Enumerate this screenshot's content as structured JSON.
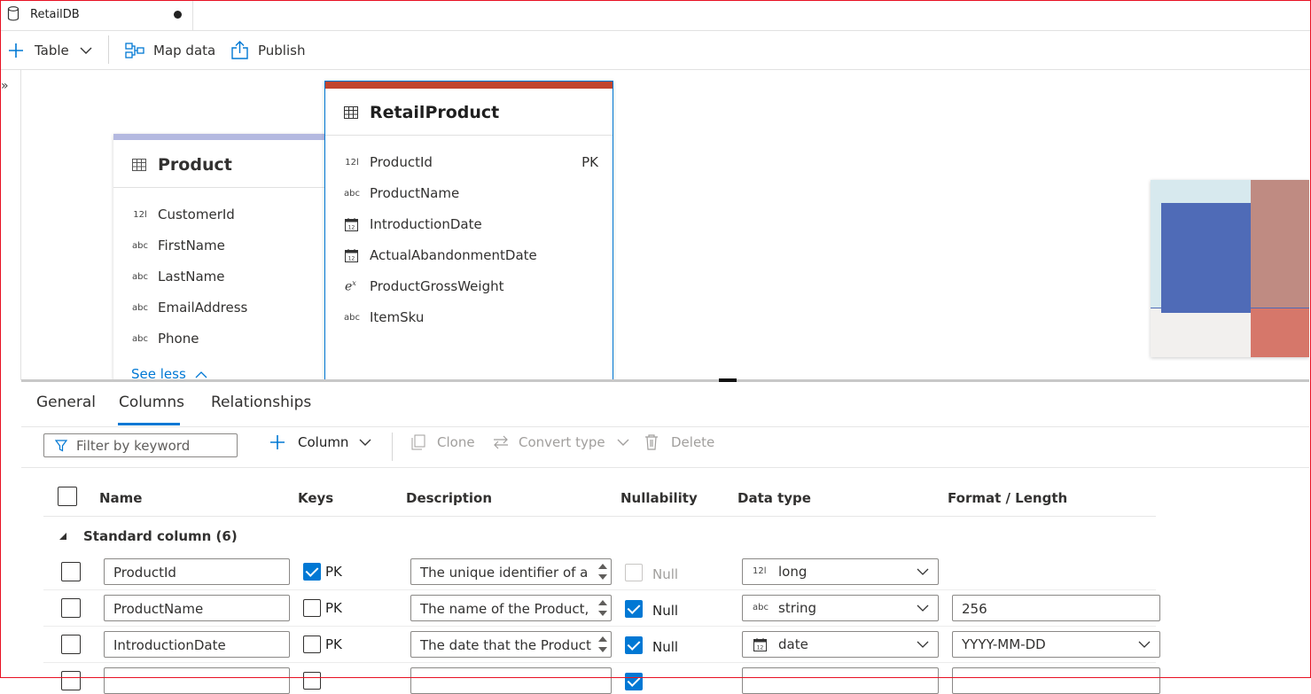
{
  "tab": {
    "title": "RetailDB"
  },
  "toolbar": {
    "table_label": "Table",
    "map_data_label": "Map data",
    "publish_label": "Publish"
  },
  "canvas": {
    "product_card": {
      "title": "Product",
      "columns": [
        {
          "type_icon": "12l",
          "name": "CustomerId"
        },
        {
          "type_icon": "abc",
          "name": "FirstName"
        },
        {
          "type_icon": "abc",
          "name": "LastName"
        },
        {
          "type_icon": "abc",
          "name": "EmailAddress"
        },
        {
          "type_icon": "abc",
          "name": "Phone"
        }
      ],
      "see_less": "See less",
      "accent": "#b4b9e0"
    },
    "retail_product_card": {
      "title": "RetailProduct",
      "accent": "#c1442e",
      "columns": [
        {
          "type_icon": "12l",
          "name": "ProductId",
          "key": "PK"
        },
        {
          "type_icon": "abc",
          "name": "ProductName",
          "key": ""
        },
        {
          "type_icon": "calendar-icon",
          "name": "IntroductionDate",
          "key": ""
        },
        {
          "type_icon": "calendar-icon",
          "name": "ActualAbandonmentDate",
          "key": ""
        },
        {
          "type_icon": "exponent-icon",
          "name": "ProductGrossWeight",
          "key": ""
        },
        {
          "type_icon": "abc",
          "name": "ItemSku",
          "key": ""
        }
      ]
    },
    "minimap_colors": [
      "#d7e9ee",
      "#4f6bb7",
      "#bf8b82",
      "#f2f0ee",
      "#d6776a"
    ]
  },
  "panel": {
    "tabs": [
      "General",
      "Columns",
      "Relationships"
    ],
    "active_tab": "Columns",
    "filter_placeholder": "Filter by keyword",
    "column_label": "Column",
    "clone_label": "Clone",
    "convert_type_label": "Convert type",
    "delete_label": "Delete",
    "headers": {
      "name": "Name",
      "keys": "Keys",
      "description": "Description",
      "nullability": "Nullability",
      "data_type": "Data type",
      "format_length": "Format / Length"
    },
    "group_label": "Standard column (6)",
    "rows": [
      {
        "name": "ProductId",
        "pk_checked": true,
        "pk_label": "PK",
        "description": "The unique identifier of a",
        "null_checked": false,
        "null_disabled": true,
        "null_label": "Null",
        "type_icon": "12l",
        "data_type": "long",
        "format": ""
      },
      {
        "name": "ProductName",
        "pk_checked": false,
        "pk_label": "PK",
        "description": "The name of the Product,",
        "null_checked": true,
        "null_disabled": false,
        "null_label": "Null",
        "type_icon": "abc",
        "data_type": "string",
        "format": "256"
      },
      {
        "name": "IntroductionDate",
        "pk_checked": false,
        "pk_label": "PK",
        "description": "The date that the Product",
        "null_checked": true,
        "null_disabled": false,
        "null_label": "Null",
        "type_icon": "calendar-icon",
        "data_type": "date",
        "format": "YYYY-MM-DD"
      }
    ]
  }
}
